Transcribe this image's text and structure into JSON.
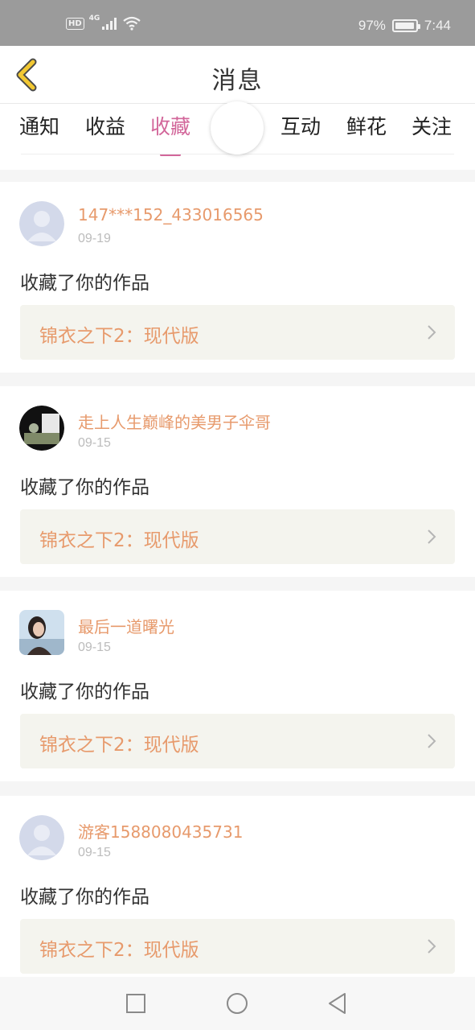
{
  "status_bar": {
    "hd": "HD",
    "network": "4G",
    "battery_percent": "97%",
    "battery_level": 0.97,
    "time": "7:44"
  },
  "header": {
    "title": "消息"
  },
  "tabs": [
    {
      "label": "通知",
      "active": false
    },
    {
      "label": "收益",
      "active": false
    },
    {
      "label": "收藏",
      "active": true
    },
    {
      "label": "互动",
      "active": false
    },
    {
      "label": "鲜花",
      "active": false
    },
    {
      "label": "关注",
      "active": false
    }
  ],
  "notifications": [
    {
      "user": "147***152_433016565",
      "date": "09-19",
      "action": "收藏了你的作品",
      "work": "锦衣之下2：现代版",
      "avatar": "default-avatar"
    },
    {
      "user": "走上人生巅峰的美男子伞哥",
      "date": "09-15",
      "action": "收藏了你的作品",
      "work": "锦衣之下2：现代版",
      "avatar": "photo-avatar"
    },
    {
      "user": "最后一道曙光",
      "date": "09-15",
      "action": "收藏了你的作品",
      "work": "锦衣之下2：现代版",
      "avatar": "photo-avatar"
    },
    {
      "user": "游客1588080435731",
      "date": "09-15",
      "action": "收藏了你的作品",
      "work": "锦衣之下2：现代版",
      "avatar": "default-avatar"
    }
  ],
  "colors": {
    "accent": "#d2669a",
    "username": "#e79a6c",
    "work_bg": "#f4f4ee"
  }
}
